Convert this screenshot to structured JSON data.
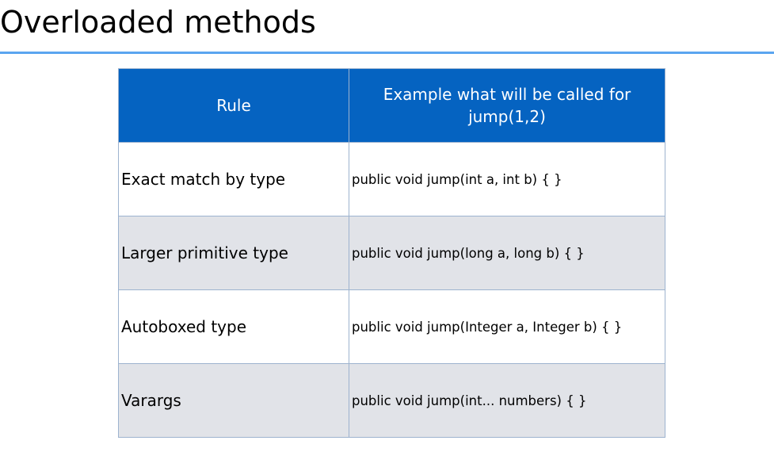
{
  "title": "Overloaded methods",
  "table": {
    "headers": [
      "Rule",
      "Example what will be called for jump(1,2)"
    ],
    "rows": [
      {
        "rule": "Exact match by type",
        "example": "public void jump(int a, int b) { }"
      },
      {
        "rule": "Larger primitive type",
        "example": "public void jump(long a, long b) { }"
      },
      {
        "rule": "Autoboxed type",
        "example": "public void jump(Integer a, Integer b) { }"
      },
      {
        "rule": "Varargs",
        "example": "public void jump(int... numbers) { }"
      }
    ]
  },
  "colors": {
    "header_bg": "#0563c1",
    "accent_line": "#5aa5f0",
    "alt_row": "#e1e3e8"
  }
}
